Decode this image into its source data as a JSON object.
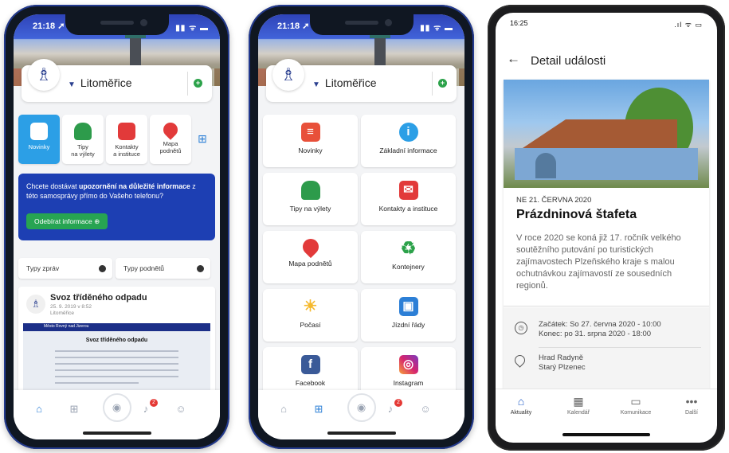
{
  "phone1": {
    "status": {
      "time": "21:18 ➚",
      "icons": "▮▮ ᯤ ▬"
    },
    "town": "Litoměřice",
    "tiles": [
      {
        "label": "Novinky",
        "icon": "news-icon"
      },
      {
        "label": "Tipy\nna výlety",
        "icon": "backpack-icon"
      },
      {
        "label": "Kontakty\na instituce",
        "icon": "contacts-icon"
      },
      {
        "label": "Mapa\npodnětů",
        "icon": "map-pin-icon"
      }
    ],
    "promo": {
      "text_pre": "Chcete dostávat ",
      "text_bold": "upozornění na důležité informace",
      "text_post": " z této samosprávy přímo do Vašeho telefonu?",
      "button": "Odebírat informace ⊕"
    },
    "filters": [
      "Typy zpráv",
      "Typy podnětů"
    ],
    "news": {
      "title": "Svoz tříděného odpadu",
      "date": "25. 9. 2019 v 8:52",
      "source": "Litoměřice",
      "doc_title": "Svoz tříděného odpadu",
      "doc_brand": "Město Rovný nad Jizerou"
    }
  },
  "phone2": {
    "status": {
      "time": "21:18 ➚",
      "icons": "▮▮ ᯤ ▬"
    },
    "town": "Litoměřice",
    "grid": [
      {
        "label": "Novinky",
        "icon": "news-icon",
        "color": "#e8503a"
      },
      {
        "label": "Základní informace",
        "icon": "info-icon",
        "color": "#2c9fe6"
      },
      {
        "label": "Tipy na výlety",
        "icon": "backpack-icon",
        "color": "#2d9b4b"
      },
      {
        "label": "Kontakty a instituce",
        "icon": "contacts-icon",
        "color": "#e23a3a"
      },
      {
        "label": "Mapa podnětů",
        "icon": "map-pin-icon",
        "color": "#e23a3a"
      },
      {
        "label": "Kontejnery",
        "icon": "recycle-icon",
        "color": "#2ca24a"
      },
      {
        "label": "Počasí",
        "icon": "weather-icon",
        "color": "#f5b92e"
      },
      {
        "label": "Jízdní řády",
        "icon": "train-icon",
        "color": "#2c7fd6"
      },
      {
        "label": "Facebook",
        "icon": "facebook-icon",
        "color": "#3a5a98"
      },
      {
        "label": "Instagram",
        "icon": "instagram-icon",
        "color": "#d6246e"
      }
    ]
  },
  "phone3": {
    "status": {
      "time": "16:25",
      "icons": ".ıl ᯤ ▭"
    },
    "header": "Detail události",
    "event": {
      "date": "NE 21. ČERVNA 2020",
      "title": "Prázdninová štafeta",
      "description": "V roce 2020 se koná již 17. ročník velkého soutěžního putování po turistických zajímavostech Plzeňského kraje s malou ochutnávkou zajímavostí ze sousedních regionů.",
      "start": "Začátek: So 27. června 2020 - 10:00",
      "end": "Konec: po 31. srpna 2020 - 18:00",
      "place1": "Hrad Radyně",
      "place2": "Starý Plzenec"
    },
    "tabs": [
      {
        "label": "Aktuality",
        "icon": "home-icon"
      },
      {
        "label": "Kalendář",
        "icon": "calendar-icon"
      },
      {
        "label": "Komunikace",
        "icon": "chat-icon"
      },
      {
        "label": "Další",
        "icon": "more-icon"
      }
    ]
  }
}
